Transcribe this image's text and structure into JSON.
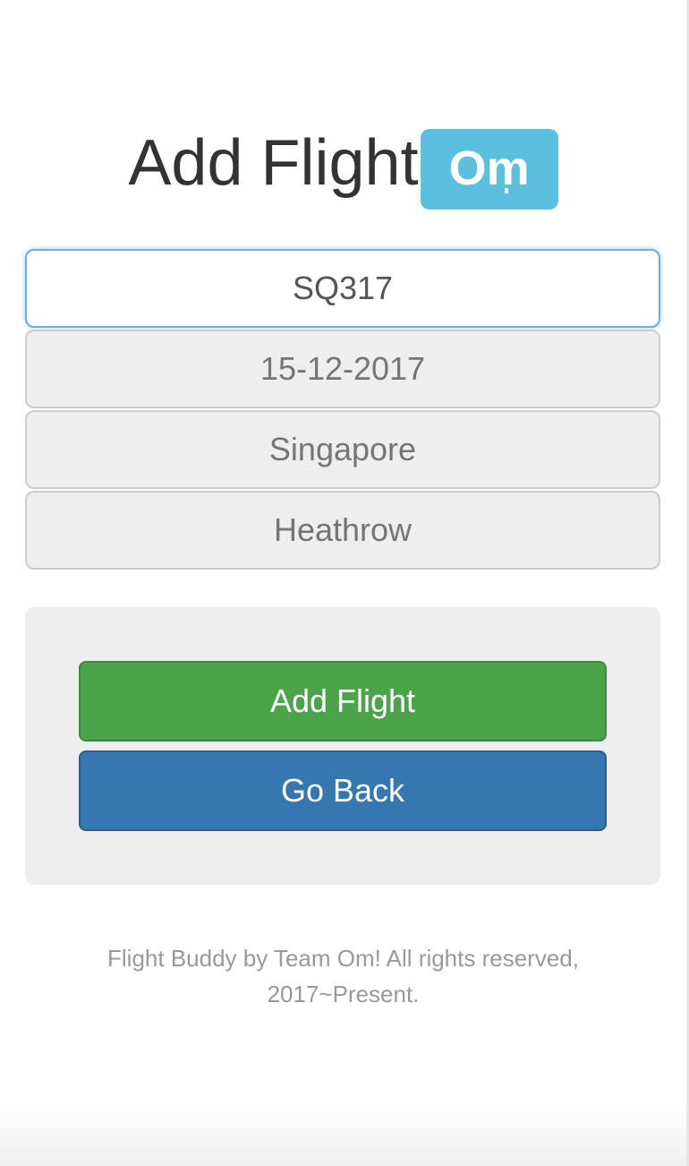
{
  "header": {
    "title": "Add Flight",
    "logo_text": "Om"
  },
  "form": {
    "flight_number": {
      "value": "SQ317"
    },
    "date": {
      "placeholder": "15-12-2017"
    },
    "origin": {
      "placeholder": "Singapore"
    },
    "destination": {
      "placeholder": "Heathrow"
    }
  },
  "actions": {
    "add_label": "Add Flight",
    "back_label": "Go Back"
  },
  "footer": {
    "line1": "Flight Buddy by Team Om! All rights reserved,",
    "line2": "2017~Present."
  },
  "colors": {
    "logo_bg": "#5bc0de",
    "success": "#4aa44a",
    "primary": "#3577b0",
    "focus_border": "#66afe9"
  }
}
